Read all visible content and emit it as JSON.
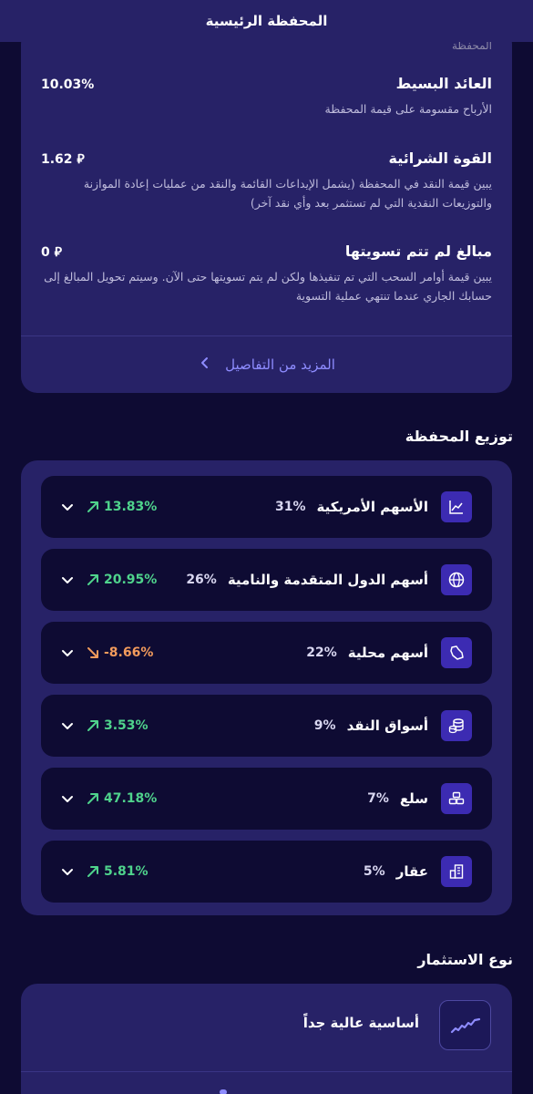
{
  "header": {
    "title": "المحفظة الرئيسية"
  },
  "details": {
    "cut_label": "المحفظة",
    "simple_return": {
      "title": "العائد البسيط",
      "value": "10.03%",
      "desc": "الأرباح مقسومة على قيمة المحفظة"
    },
    "purchasing_power": {
      "title": "القوة الشرائية",
      "value": "1.62 ⃁",
      "desc": "يبين قيمة النقد في المحفظة (يشمل الإيداعات القائمة والنقد من عمليات إعادة الموازنة والتوزيعات النقدية التي لم تستثمر بعد وأي نقد آخر)"
    },
    "unsettled": {
      "title": "مبالغ لم تتم تسويتها",
      "value": "0 ⃁",
      "desc": "يبين قيمة أوامر السحب التي تم تنفيذها ولكن لم يتم تسويتها حتى الآن. وسيتم تحويل المبالغ إلى حسابك الجاري عندما تنتهي عملية التسوية"
    },
    "more_label": "المزيد من التفاصيل"
  },
  "allocation": {
    "title": "توزيع المحفظة",
    "rows": [
      {
        "name": "الأسهم الأمريكية",
        "percent": "31%",
        "perf": "13.83%",
        "trend": "up",
        "icon": "line-chart-icon"
      },
      {
        "name": "أسهم الدول المتقدمة والنامية",
        "percent": "26%",
        "perf": "20.95%",
        "trend": "up",
        "icon": "globe-icon"
      },
      {
        "name": "أسهم محلية",
        "percent": "22%",
        "perf": "-8.66%",
        "trend": "down",
        "icon": "saudi-map-icon"
      },
      {
        "name": "أسواق النقد",
        "percent": "9%",
        "perf": "3.53%",
        "trend": "up",
        "icon": "coins-icon"
      },
      {
        "name": "سلع",
        "percent": "7%",
        "perf": "47.18%",
        "trend": "up",
        "icon": "gold-bars-icon"
      },
      {
        "name": "عقار",
        "percent": "5%",
        "perf": "5.81%",
        "trend": "up",
        "icon": "building-icon"
      }
    ]
  },
  "investment_type": {
    "title": "نوع الاستثمار",
    "label": "أساسية عالية جداً",
    "icon": "growth-line-icon"
  },
  "colors": {
    "up": "#4fd38c",
    "down": "#f29b5c",
    "accent": "#8e8cff",
    "card": "#272267",
    "background": "#0e0b33"
  }
}
